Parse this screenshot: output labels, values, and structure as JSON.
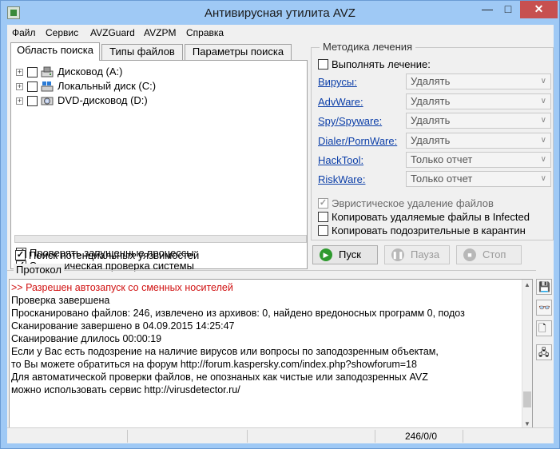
{
  "window": {
    "title": "Антивирусная утилита AVZ",
    "minimize": "—",
    "maximize": "□",
    "close": "✕"
  },
  "menu": [
    "Файл",
    "Сервис",
    "AVZGuard",
    "AVZPM",
    "Справка"
  ],
  "tabs": [
    "Область поиска",
    "Типы файлов",
    "Параметры поиска"
  ],
  "tree": [
    {
      "label": "Дисковод (A:)",
      "icon": "floppy-drive-icon"
    },
    {
      "label": "Локальный диск (C:)",
      "icon": "local-disk-icon"
    },
    {
      "label": "DVD-дисковод (D:)",
      "icon": "dvd-drive-icon"
    }
  ],
  "scan_options": [
    {
      "label": "Проверять запущенные процессы",
      "checked": true
    },
    {
      "label": "Эвристическая проверка системы",
      "checked": true
    },
    {
      "label": "Поиск потенциальных уязвимостей",
      "checked": true
    }
  ],
  "cure": {
    "title": "Методика лечения",
    "perform_label": "Выполнять лечение:",
    "rows": [
      {
        "link": "Вирусы:",
        "value": "Удалять"
      },
      {
        "link": "AdvWare:",
        "value": "Удалять"
      },
      {
        "link": "Spy/Spyware:",
        "value": "Удалять"
      },
      {
        "link": "Dialer/PornWare:",
        "value": "Удалять"
      },
      {
        "link": "HackTool:",
        "value": "Только отчет"
      },
      {
        "link": "RiskWare:",
        "value": "Только отчет"
      }
    ],
    "heuristic_delete": "Эвристическое удаление файлов",
    "copy_deleted": "Копировать удаляемые файлы в  Infected",
    "copy_suspicious": "Копировать подозрительные в  карантин"
  },
  "buttons": {
    "start": "Пуск",
    "pause": "Пауза",
    "stop": "Стоп"
  },
  "protocol": {
    "title": "Протокол",
    "lines": [
      ">> Разрешен автозапуск со сменных носителей",
      "Проверка завершена",
      "Просканировано файлов: 246, извлечено из архивов: 0, найдено вредоносных программ 0, подоз",
      "Сканирование завершено в 04.09.2015 14:25:47",
      "Сканирование длилось 00:00:19",
      "Если у Вас есть подозрение на наличие вирусов или вопросы по заподозренным объектам,",
      "то Вы можете обратиться на форум http://forum.kaspersky.com/index.php?showforum=18",
      "Для автоматической проверки файлов, не опознаных как чистые или заподозренных AVZ",
      "можно использовать сервис http://virusdetector.ru/"
    ]
  },
  "status": {
    "counter": "246/0/0"
  },
  "colors": {
    "titlebar": "#9fc9f5",
    "link": "#0b3ea8",
    "log_alert": "#d01010",
    "start_icon": "#2e9a2e"
  }
}
